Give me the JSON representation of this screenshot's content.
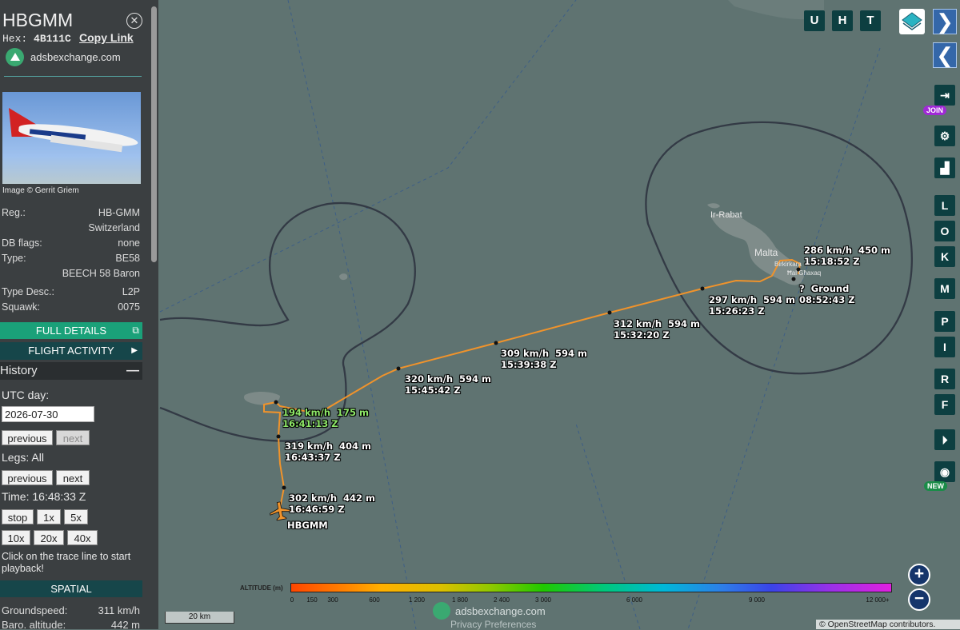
{
  "aircraft": {
    "callsign": "HBGMM",
    "hex_label": "Hex:",
    "hex": "4B111C",
    "copy_link": "Copy Link",
    "site": "adsbexchange.com",
    "photo_credit": "Image © Gerrit Griem"
  },
  "details": [
    {
      "key": "Reg.:",
      "value": "HB-GMM"
    },
    {
      "key": "",
      "value": "Switzerland"
    },
    {
      "key": "DB flags:",
      "value": "none"
    },
    {
      "key": "Type:",
      "value": "BE58"
    },
    {
      "key": "",
      "value": "BEECH 58 Baron"
    },
    {
      "key": "Type Desc.:",
      "value": "L2P"
    },
    {
      "key": "Squawk:",
      "value": "0075"
    }
  ],
  "buttons": {
    "full_details": "FULL DETAILS",
    "flight_activity": "FLIGHT ACTIVITY",
    "history": "History",
    "spatial": "SPATIAL"
  },
  "history": {
    "utc_day_label": "UTC day:",
    "date": "2026-07-30",
    "previous": "previous",
    "next": "next",
    "legs_label": "Legs: All",
    "time_label": "Time: 16:48:33 Z",
    "speeds": [
      "stop",
      "1x",
      "5x",
      "10x",
      "20x",
      "40x"
    ],
    "hint": "Click on the trace line to start playback!"
  },
  "spatial": [
    {
      "key": "Groundspeed:",
      "value": "311 km/h"
    },
    {
      "key": "Baro. altitude:",
      "value": "442 m"
    }
  ],
  "map": {
    "top_buttons": [
      "U",
      "H",
      "T"
    ],
    "right_buttons": [
      "L",
      "O",
      "K",
      "M",
      "P",
      "I",
      "R",
      "F"
    ],
    "join_badge": "JOIN",
    "new_badge": "NEW",
    "places": [
      "Ir-Rabat",
      "Malta",
      "Birkirkara",
      "Ħal Għaxaq"
    ],
    "labels": [
      {
        "speed": "286 km/h",
        "alt": "450 m",
        "time": "15:18:52 Z"
      },
      {
        "speed": "?",
        "alt": "Ground",
        "time": "08:52:43 Z"
      },
      {
        "speed": "297 km/h",
        "alt": "594 m",
        "time": "15:26:23 Z"
      },
      {
        "speed": "312 km/h",
        "alt": "594 m",
        "time": "15:32:20 Z"
      },
      {
        "speed": "309 km/h",
        "alt": "594 m",
        "time": "15:39:38 Z"
      },
      {
        "speed": "320 km/h",
        "alt": "594 m",
        "time": "15:45:42 Z"
      },
      {
        "speed": "194 km/h",
        "alt": "175 m",
        "time": "16:41:13 Z"
      },
      {
        "speed": "319 km/h",
        "alt": "404 m",
        "time": "16:43:37 Z"
      },
      {
        "speed": "302 km/h",
        "alt": "442 m",
        "time": "16:46:59 Z"
      }
    ],
    "aircraft_tag": "HBGMM",
    "altitude_title": "ALTITUDE (m)",
    "altitude_ticks": [
      "0",
      "150",
      "300",
      "600",
      "1 200",
      "1 800",
      "2 400",
      "3 000",
      "6 000",
      "9 000",
      "12 000+"
    ],
    "scale": "20 km",
    "watermark": "adsbexchange.com",
    "privacy": "Privacy Preferences",
    "attribution": "© OpenStreetMap contributors."
  }
}
